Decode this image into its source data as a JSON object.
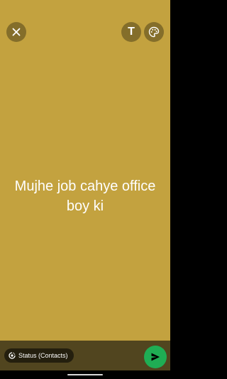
{
  "colors": {
    "background": "#c3a23f",
    "bottom_bar": "#51451f",
    "send_button": "#1fad54",
    "text": "#ffffff"
  },
  "toolbar": {
    "close_icon": "close-icon",
    "text_tool_glyph": "T",
    "palette_icon": "palette-icon"
  },
  "status": {
    "text": "Mujhe job cahye office boy ki"
  },
  "footer": {
    "audience_label": "Status (Contacts)",
    "audience_icon": "status-ring-icon",
    "send_icon": "send-icon"
  }
}
